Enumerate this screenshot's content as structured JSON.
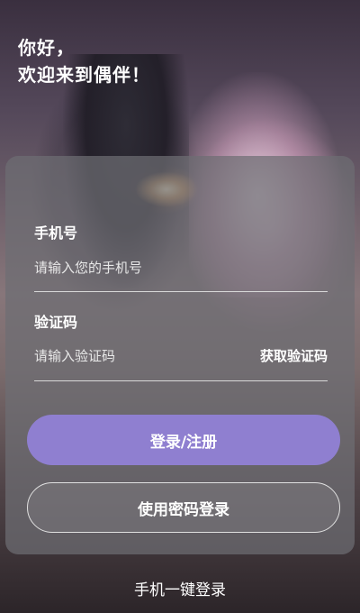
{
  "greeting": {
    "line1": "你好，",
    "line2": "欢迎来到偶伴！"
  },
  "phone": {
    "label": "手机号",
    "placeholder": "请输入您的手机号",
    "value": ""
  },
  "code": {
    "label": "验证码",
    "placeholder": "请输入验证码",
    "value": "",
    "get_code_label": "获取验证码"
  },
  "buttons": {
    "login_register": "登录/注册",
    "password_login": "使用密码登录",
    "one_click_login": "手机一键登录"
  },
  "colors": {
    "accent": "#8f7fd0"
  }
}
